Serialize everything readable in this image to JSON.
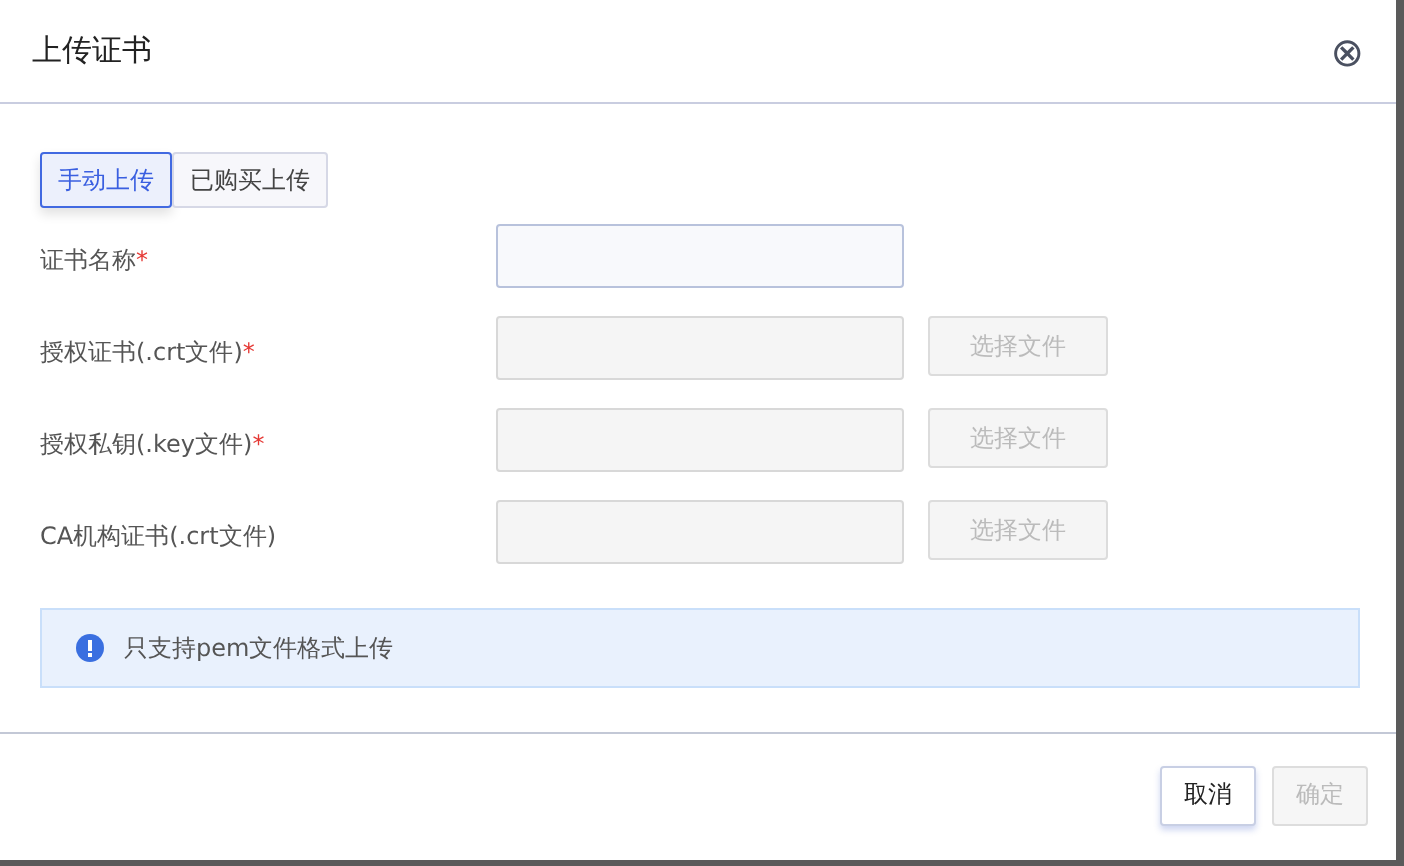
{
  "dialog": {
    "title": "上传证书",
    "close_icon": "⊗"
  },
  "tabs": [
    {
      "label": "手动上传",
      "selected": true
    },
    {
      "label": "已购买上传",
      "selected": false
    }
  ],
  "fields": [
    {
      "kind": "text",
      "label": "证书名称",
      "required_mark": "*"
    },
    {
      "kind": "file",
      "label": "授权证书(.crt文件)",
      "required_mark": "*",
      "button": {
        "label": "选择文件",
        "disabled": true
      }
    },
    {
      "kind": "file",
      "label": "授权私钥(.key文件)",
      "required_mark": "*",
      "button": {
        "label": "选择文件",
        "disabled": true
      }
    },
    {
      "kind": "file",
      "label": "CA机构证书(.crt文件)",
      "button": {
        "label": "选择文件",
        "disabled": true
      }
    }
  ],
  "notice": {
    "text": "只支持pem文件格式上传"
  },
  "buttons": [
    {
      "label": "取消",
      "disabled": false
    },
    {
      "label": "确定",
      "disabled": true
    }
  ]
}
